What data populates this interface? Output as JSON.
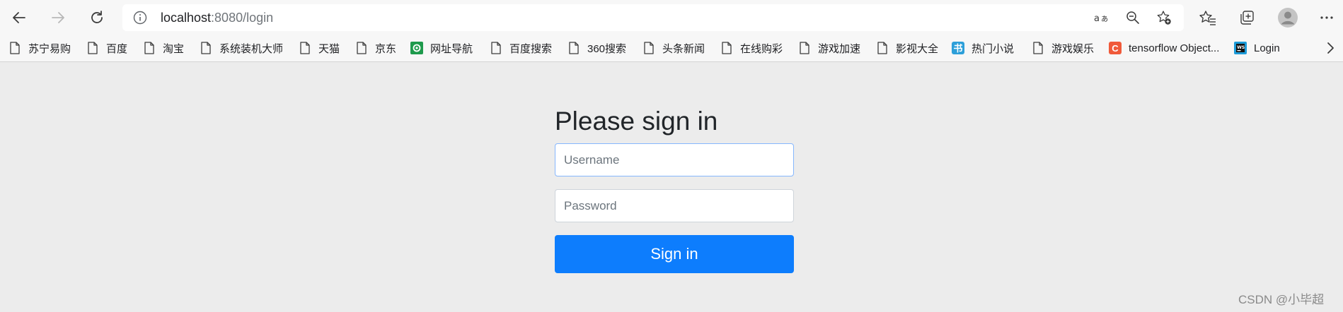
{
  "browser": {
    "url_host": "localhost",
    "url_rest": ":8080/login"
  },
  "icons": {
    "back": "back-arrow-icon",
    "forward": "forward-arrow-icon",
    "reload": "reload-icon",
    "info": "info-icon",
    "read_aloud": "read-aloud-icon",
    "zoom": "zoom-out-icon",
    "add_favorite": "add-favorite-star-icon",
    "favorites": "favorites-icon",
    "collections": "collections-icon",
    "profile": "profile-avatar-icon",
    "more": "more-dots-icon"
  },
  "bookmarks": [
    {
      "label": "苏宁易购",
      "icon": "page"
    },
    {
      "label": "百度",
      "icon": "page"
    },
    {
      "label": "淘宝",
      "icon": "page"
    },
    {
      "label": "系统装机大师",
      "icon": "page"
    },
    {
      "label": "天猫",
      "icon": "page"
    },
    {
      "label": "京东",
      "icon": "page"
    },
    {
      "label": "网址导航",
      "icon": "green-badge"
    },
    {
      "label": "百度搜索",
      "icon": "page"
    },
    {
      "label": "360搜索",
      "icon": "page"
    },
    {
      "label": "头条新闻",
      "icon": "page"
    },
    {
      "label": "在线购彩",
      "icon": "page"
    },
    {
      "label": "游戏加速",
      "icon": "page"
    },
    {
      "label": "影视大全",
      "icon": "page"
    },
    {
      "label": "热门小说",
      "icon": "book-badge",
      "badge_text": "书"
    },
    {
      "label": "游戏娱乐",
      "icon": "page"
    },
    {
      "label": "tensorflow Object...",
      "icon": "c-badge",
      "badge_text": "C"
    },
    {
      "label": "Login",
      "icon": "ws-badge"
    }
  ],
  "login": {
    "heading": "Please sign in",
    "username_placeholder": "Username",
    "password_placeholder": "Password",
    "sign_in_label": "Sign in"
  },
  "watermark": "CSDN @小毕超",
  "colors": {
    "primary_button": "#0d7dfd",
    "page_background": "#ececec",
    "focus_border": "#86b7fe"
  }
}
